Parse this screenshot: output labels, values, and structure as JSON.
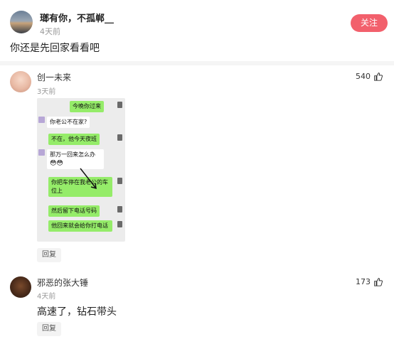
{
  "post": {
    "author": "瑯有你，不孤郸__",
    "time": "4天前",
    "follow_label": "关注",
    "text": "你还是先回家看看吧"
  },
  "comments": [
    {
      "name": "创一未来",
      "time": "3天前",
      "likes": "540",
      "reply_label": "回复",
      "chat": {
        "messages": [
          {
            "side": "right",
            "text": "今晚你过来"
          },
          {
            "side": "left",
            "text": "你老公不在家?"
          },
          {
            "side": "right",
            "text": "不在，他今天夜班"
          },
          {
            "side": "left",
            "text": "那万一回来怎么办"
          },
          {
            "side": "right",
            "text": "你把车停在我老公的车位上"
          },
          {
            "side": "right",
            "text": "然后留下电话号码"
          },
          {
            "side": "right",
            "text": "他回来就会给你打电话"
          }
        ]
      }
    },
    {
      "name": "邪恶的张大锤",
      "time": "4天前",
      "likes": "173",
      "text": "高速了，钻石带头",
      "reply_label": "回复"
    }
  ],
  "colors": {
    "follow_bg": "#f2606c",
    "bubble_green": "#95ec69"
  }
}
